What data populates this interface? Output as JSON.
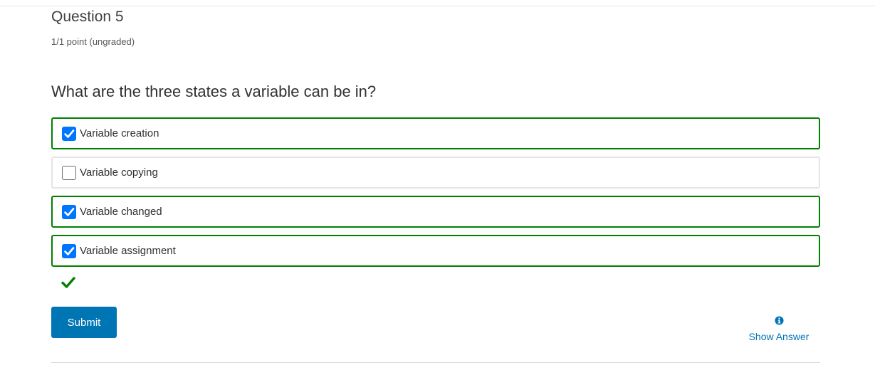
{
  "question": {
    "title": "Question 5",
    "points": "1/1 point (ungraded)",
    "prompt": "What are the three states a variable can be in?"
  },
  "options": [
    {
      "label": "Variable creation",
      "checked": true
    },
    {
      "label": "Variable copying",
      "checked": false
    },
    {
      "label": "Variable changed",
      "checked": true
    },
    {
      "label": "Variable assignment",
      "checked": true
    }
  ],
  "result": {
    "status": "correct",
    "icon": "checkmark-icon",
    "color": "#008100"
  },
  "actions": {
    "submit_label": "Submit",
    "show_answer_label": "Show Answer",
    "show_answer_icon": "info-icon"
  },
  "colors": {
    "correct_border": "#008100",
    "accent": "#0075b4",
    "checkbox_blue": "#0075ff"
  }
}
